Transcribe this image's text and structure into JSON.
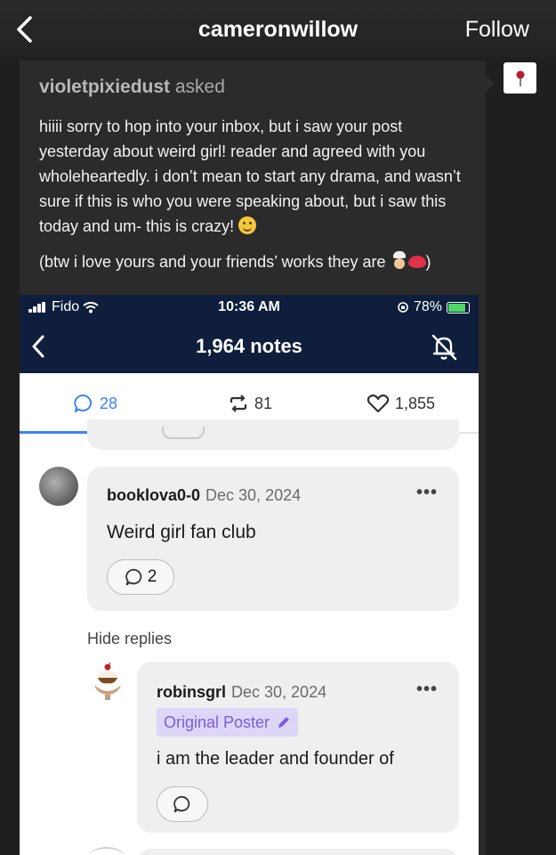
{
  "header": {
    "title": "cameronwillow",
    "follow_label": "Follow"
  },
  "ask": {
    "asker": "violetpixiedust",
    "asked_label": "asked",
    "paragraph1": "hiiii sorry to hop into your inbox, but i saw your post yesterday about weird girl! reader and agreed with you wholeheartedly. i don’t mean to start any drama, and wasn’t sure if this is who you were speaking about, but i saw this today and um- this is crazy!",
    "paragraph2_start": "(btw i love yours and your friends’ works they are",
    "paragraph2_end": ")"
  },
  "screenshot": {
    "status": {
      "carrier": "Fido",
      "time": "10:36 AM",
      "battery": "78%"
    },
    "notes_title": "1,964 notes",
    "tabs": {
      "replies": "28",
      "reblogs": "81",
      "likes": "1,855"
    },
    "comment": {
      "username": "booklova0-0",
      "date": "Dec 30, 2024",
      "text": "Weird girl fan club",
      "reply_count": "2"
    },
    "hide_replies_label": "Hide replies",
    "reply": {
      "username": "robinsgrl",
      "date": "Dec 30, 2024",
      "badge": "Original Poster",
      "text": "i am the leader and founder of"
    }
  },
  "colors": {
    "screenshot_nav": "#0f1e3c",
    "accent_blue": "#3b82f6",
    "op_badge_bg": "#ddd6f7",
    "op_badge_text": "#7c5ce0"
  }
}
